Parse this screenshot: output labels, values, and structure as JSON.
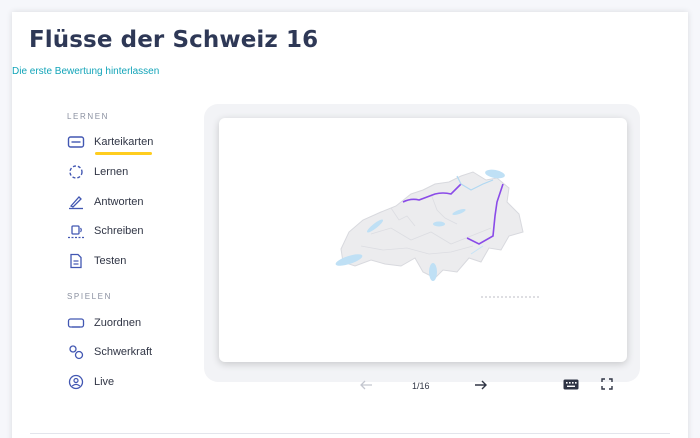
{
  "header": {
    "title": "Flüsse der Schweiz 16",
    "rating_link": "Die erste Bewertung hinterlassen"
  },
  "sidebar": {
    "sections": [
      {
        "label": "LERNEN",
        "items": [
          {
            "label": "Karteikarten",
            "icon": "flashcards-icon",
            "active": true
          },
          {
            "label": "Lernen",
            "icon": "learn-icon"
          },
          {
            "label": "Antworten",
            "icon": "write-icon"
          },
          {
            "label": "Schreiben",
            "icon": "spell-icon"
          },
          {
            "label": "Testen",
            "icon": "test-icon"
          }
        ]
      },
      {
        "label": "SPIELEN",
        "items": [
          {
            "label": "Zuordnen",
            "icon": "match-icon"
          },
          {
            "label": "Schwerkraft",
            "icon": "gravity-icon"
          },
          {
            "label": "Live",
            "icon": "live-icon"
          }
        ]
      }
    ]
  },
  "card": {
    "image": "Schweiz-Karte mit markiertem Fluss",
    "highlight_color": "#8a4be8"
  },
  "controls": {
    "counter": "1/16",
    "prev_icon": "arrow-left-icon",
    "next_icon": "arrow-right-icon",
    "keyboard_icon": "keyboard-icon",
    "fullscreen_icon": "fullscreen-icon"
  },
  "colors": {
    "accent_underline": "#ffcd1f",
    "link": "#12a4b8",
    "title": "#2e3856"
  }
}
